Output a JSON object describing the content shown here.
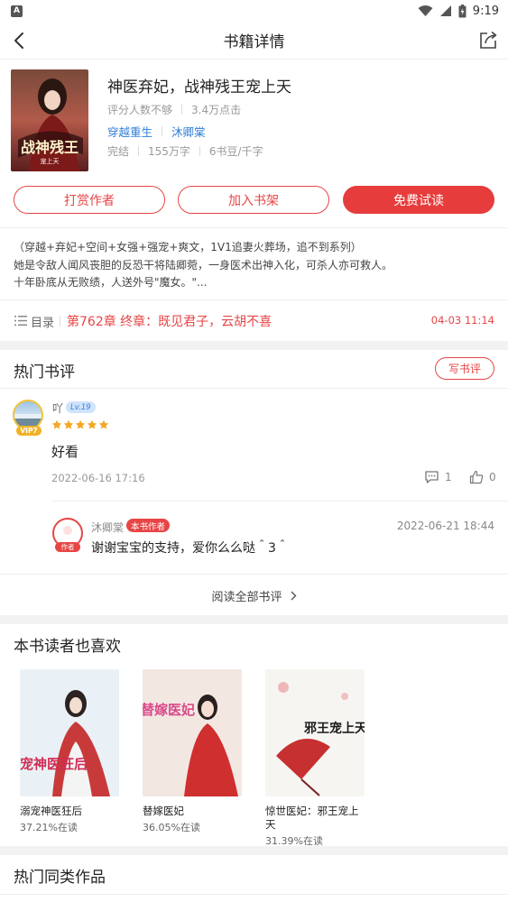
{
  "status_bar": {
    "time": "9:19",
    "left_icon": "A"
  },
  "nav": {
    "title": "书籍详情"
  },
  "book": {
    "title": "神医弃妃，战神残王宠上天",
    "rating": "评分人数不够",
    "clicks": "3.4万点击",
    "tags": [
      "穿越重生",
      "沐卿棠"
    ],
    "status": "完结",
    "words": "155万字",
    "price": "6书豆/千字"
  },
  "buttons": {
    "reward": "打赏作者",
    "add_shelf": "加入书架",
    "free_read": "免费试读"
  },
  "intro": [
    "（穿越+弃妃+空间+女强+强宠+爽文，1V1追妻火葬场，追不到系列）",
    "她是令敌人闻风丧胆的反恐干将陆卿菀，一身医术出神入化，可杀人亦可救人。",
    "十年卧底从无败绩，人送外号\"魔女。\"..."
  ],
  "toc": {
    "label": "目录",
    "latest_chapter": "第762章 终章：既见君子，云胡不喜",
    "updated": "04-03 11:14"
  },
  "hot_reviews": {
    "title": "热门书评",
    "write_label": "写书评",
    "review": {
      "user": "吖",
      "level": "Lv.19",
      "vip": "VIP7",
      "content": "好看",
      "date": "2022-06-16 17:16",
      "comments": "1",
      "likes": "0"
    },
    "reply": {
      "user": "沐卿棠",
      "badge": "本书作者",
      "avatar_tag": "作者",
      "date": "2022-06-21 18:44",
      "content": "谢谢宝宝的支持，爱你么么哒＾3＾"
    },
    "read_all": "阅读全部书评"
  },
  "also_like": {
    "title": "本书读者也喜欢",
    "items": [
      {
        "name": "溺宠神医狂后",
        "read": "37.21%在读",
        "cover_text": "溺宠神医狂后"
      },
      {
        "name": "替嫁医妃",
        "read": "36.05%在读",
        "cover_text": "替嫁医妃"
      },
      {
        "name": "惊世医妃：邪王宠上天",
        "read": "31.39%在读",
        "cover_text": "邪王宠上天"
      }
    ]
  },
  "similar": {
    "title": "热门同类作品"
  },
  "colors": {
    "accent": "#e84545",
    "link": "#2f7ed8",
    "star": "#f5a623"
  }
}
